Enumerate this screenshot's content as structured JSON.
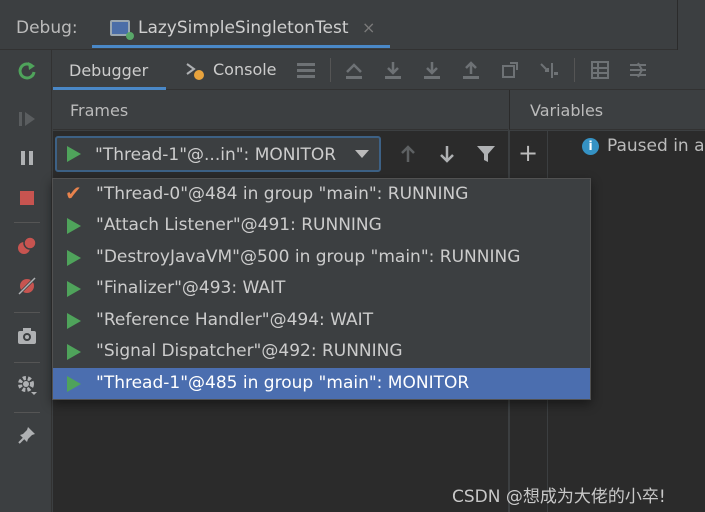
{
  "header": {
    "debug_label": "Debug:",
    "session_tab_title": "LazySimpleSingletonTest",
    "session_tab_close": "×"
  },
  "toolbar": {
    "debugger_tab": "Debugger",
    "console_tab": "Console"
  },
  "frames": {
    "title": "Frames",
    "selected_thread": "\"Thread-1\"@...in\": MONITOR"
  },
  "variables": {
    "title": "Variables",
    "status_text": "Paused in a"
  },
  "threads": [
    {
      "label": "\"Thread-0\"@484 in group \"main\": RUNNING",
      "icon": "check-icon"
    },
    {
      "label": "\"Attach Listener\"@491: RUNNING",
      "icon": "play-icon"
    },
    {
      "label": "\"DestroyJavaVM\"@500 in group \"main\": RUNNING",
      "icon": "play-icon"
    },
    {
      "label": "\"Finalizer\"@493: WAIT",
      "icon": "play-icon"
    },
    {
      "label": "\"Reference Handler\"@494: WAIT",
      "icon": "play-icon"
    },
    {
      "label": "\"Signal Dispatcher\"@492: RUNNING",
      "icon": "play-icon"
    },
    {
      "label": "\"Thread-1\"@485 in group \"main\": MONITOR",
      "icon": "play-icon",
      "selected": true
    }
  ],
  "watermark": "CSDN @想成为大佬的小卒!",
  "colors": {
    "accent": "#4a88c7",
    "selection": "#4b6eaf",
    "running_green": "#4fa35b",
    "stop_red": "#c75450",
    "check_orange": "#e8834d"
  }
}
